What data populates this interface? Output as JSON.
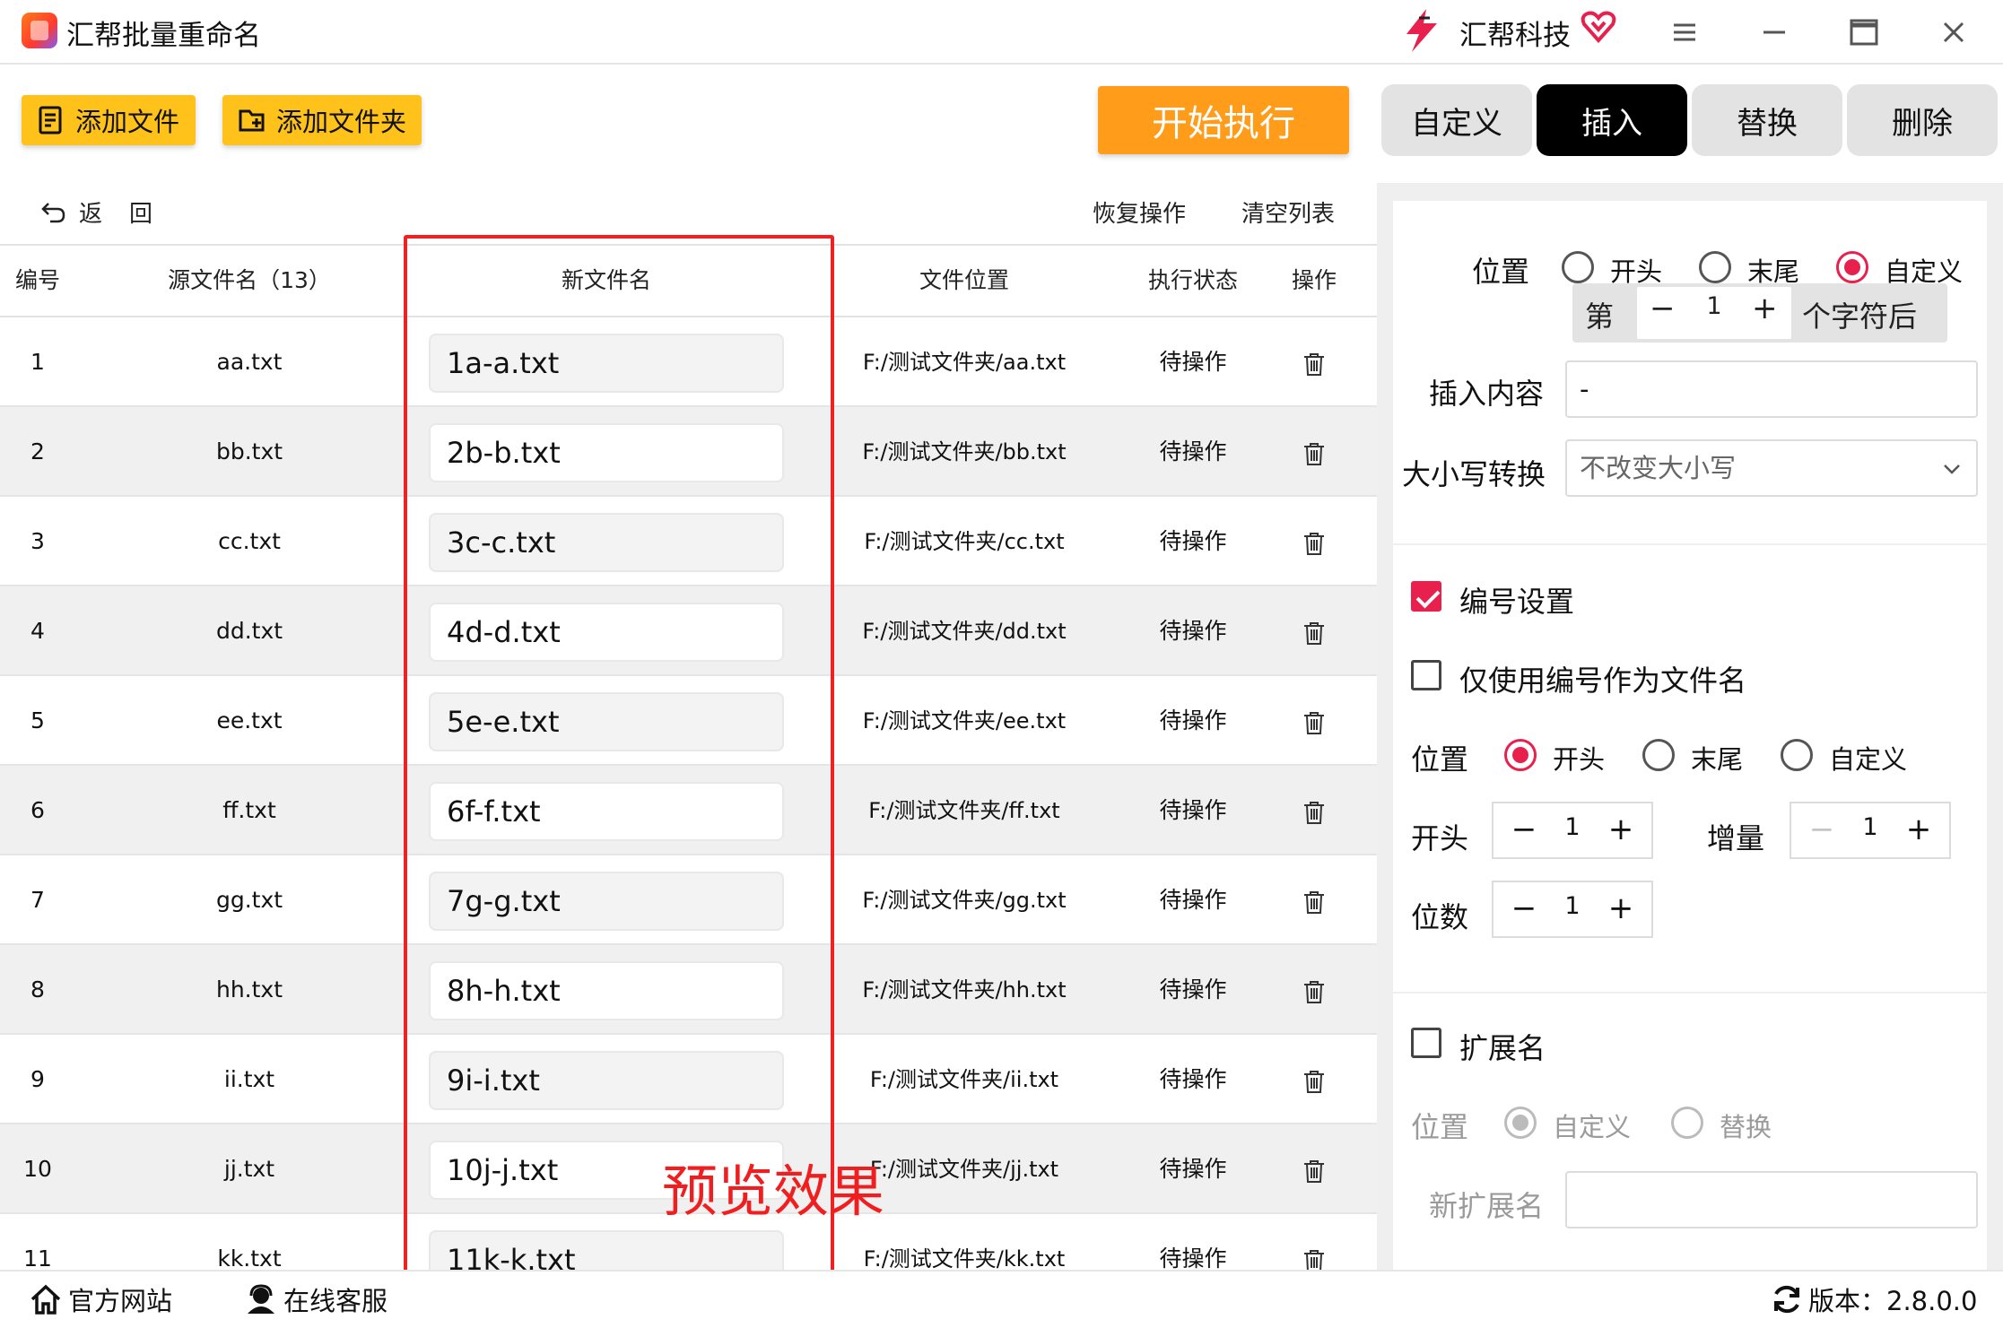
{
  "app": {
    "title": "汇帮批量重命名",
    "brand": "汇帮科技"
  },
  "toolbar": {
    "add_file": "添加文件",
    "add_folder": "添加文件夹",
    "start": "开始执行"
  },
  "tabs": [
    {
      "label": "自定义",
      "active": false
    },
    {
      "label": "插入",
      "active": true
    },
    {
      "label": "替换",
      "active": false
    },
    {
      "label": "删除",
      "active": false
    }
  ],
  "list": {
    "back": "返回",
    "restore": "恢复操作",
    "clear": "清空列表",
    "headers": [
      "编号",
      "源文件名（13）",
      "新文件名",
      "文件位置",
      "执行状态",
      "操作"
    ],
    "rows": [
      {
        "no": "1",
        "src": "aa.txt",
        "new": "1a-a.txt",
        "path": "F:/测试文件夹/aa.txt",
        "status": "待操作"
      },
      {
        "no": "2",
        "src": "bb.txt",
        "new": "2b-b.txt",
        "path": "F:/测试文件夹/bb.txt",
        "status": "待操作"
      },
      {
        "no": "3",
        "src": "cc.txt",
        "new": "3c-c.txt",
        "path": "F:/测试文件夹/cc.txt",
        "status": "待操作"
      },
      {
        "no": "4",
        "src": "dd.txt",
        "new": "4d-d.txt",
        "path": "F:/测试文件夹/dd.txt",
        "status": "待操作"
      },
      {
        "no": "5",
        "src": "ee.txt",
        "new": "5e-e.txt",
        "path": "F:/测试文件夹/ee.txt",
        "status": "待操作"
      },
      {
        "no": "6",
        "src": "ff.txt",
        "new": "6f-f.txt",
        "path": "F:/测试文件夹/ff.txt",
        "status": "待操作"
      },
      {
        "no": "7",
        "src": "gg.txt",
        "new": "7g-g.txt",
        "path": "F:/测试文件夹/gg.txt",
        "status": "待操作"
      },
      {
        "no": "8",
        "src": "hh.txt",
        "new": "8h-h.txt",
        "path": "F:/测试文件夹/hh.txt",
        "status": "待操作"
      },
      {
        "no": "9",
        "src": "ii.txt",
        "new": "9i-i.txt",
        "path": "F:/测试文件夹/ii.txt",
        "status": "待操作"
      },
      {
        "no": "10",
        "src": "jj.txt",
        "new": "10j-j.txt",
        "path": "F:/测试文件夹/jj.txt",
        "status": "待操作"
      },
      {
        "no": "11",
        "src": "kk.txt",
        "new": "11k-k.txt",
        "path": "F:/测试文件夹/kk.txt",
        "status": "待操作"
      }
    ],
    "annotation": "预览效果"
  },
  "insert": {
    "position_label": "位置",
    "position_options": [
      "开头",
      "末尾",
      "自定义"
    ],
    "position_selected": "自定义",
    "nth_prefix": "第",
    "nth_value": "1",
    "nth_suffix": "个字符后",
    "content_label": "插入内容",
    "content_value": "-",
    "case_label": "大小写转换",
    "case_value": "不改变大小写"
  },
  "numbering": {
    "enabled_label": "编号设置",
    "enabled": true,
    "only_number_label": "仅使用编号作为文件名",
    "only_number": false,
    "position_label": "位置",
    "position_options": [
      "开头",
      "末尾",
      "自定义"
    ],
    "position_selected": "开头",
    "start_label": "开头",
    "start_value": "1",
    "increment_label": "增量",
    "increment_value": "1",
    "digits_label": "位数",
    "digits_value": "1"
  },
  "extension": {
    "enabled_label": "扩展名",
    "enabled": false,
    "position_label": "位置",
    "position_options": [
      "自定义",
      "替换"
    ],
    "position_selected": "自定义",
    "new_ext_label": "新扩展名",
    "new_ext_value": ""
  },
  "footer": {
    "website": "官方网站",
    "support": "在线客服",
    "version": "版本：2.8.0.0"
  },
  "colors": {
    "accent": "#ffc21a",
    "start": "#ff9c1a",
    "active_tab": "#000000",
    "selection": "#e8204e",
    "annotation": "#ee2222"
  }
}
